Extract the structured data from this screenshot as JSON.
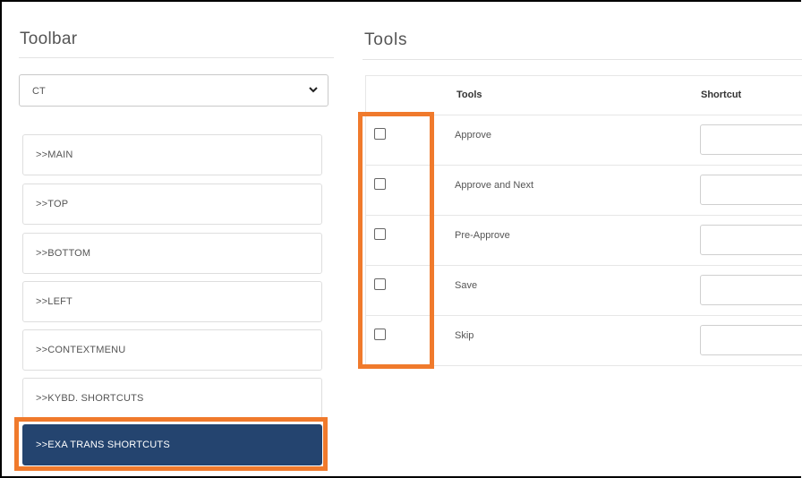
{
  "toolbar": {
    "title": "Toolbar",
    "select_value": "CT",
    "items": [
      {
        "label": ">>MAIN"
      },
      {
        "label": ">>TOP"
      },
      {
        "label": ">>BOTTOM"
      },
      {
        "label": ">>LEFT"
      },
      {
        "label": ">>CONTEXTMENU"
      },
      {
        "label": ">>KYBD. SHORTCUTS"
      },
      {
        "label": ">>EXA TRANS SHORTCUTS",
        "active": true
      }
    ]
  },
  "tools": {
    "title": "Tools",
    "columns": {
      "tools": "Tools",
      "shortcut": "Shortcut"
    },
    "rows": [
      {
        "name": "Approve",
        "checked": false,
        "shortcut": ""
      },
      {
        "name": "Approve and Next",
        "checked": false,
        "shortcut": ""
      },
      {
        "name": "Pre-Approve",
        "checked": false,
        "shortcut": ""
      },
      {
        "name": "Save",
        "checked": false,
        "shortcut": ""
      },
      {
        "name": "Skip",
        "checked": false,
        "shortcut": ""
      }
    ]
  },
  "colors": {
    "highlight": "#f07a2c",
    "active_item_bg": "#24446f"
  }
}
